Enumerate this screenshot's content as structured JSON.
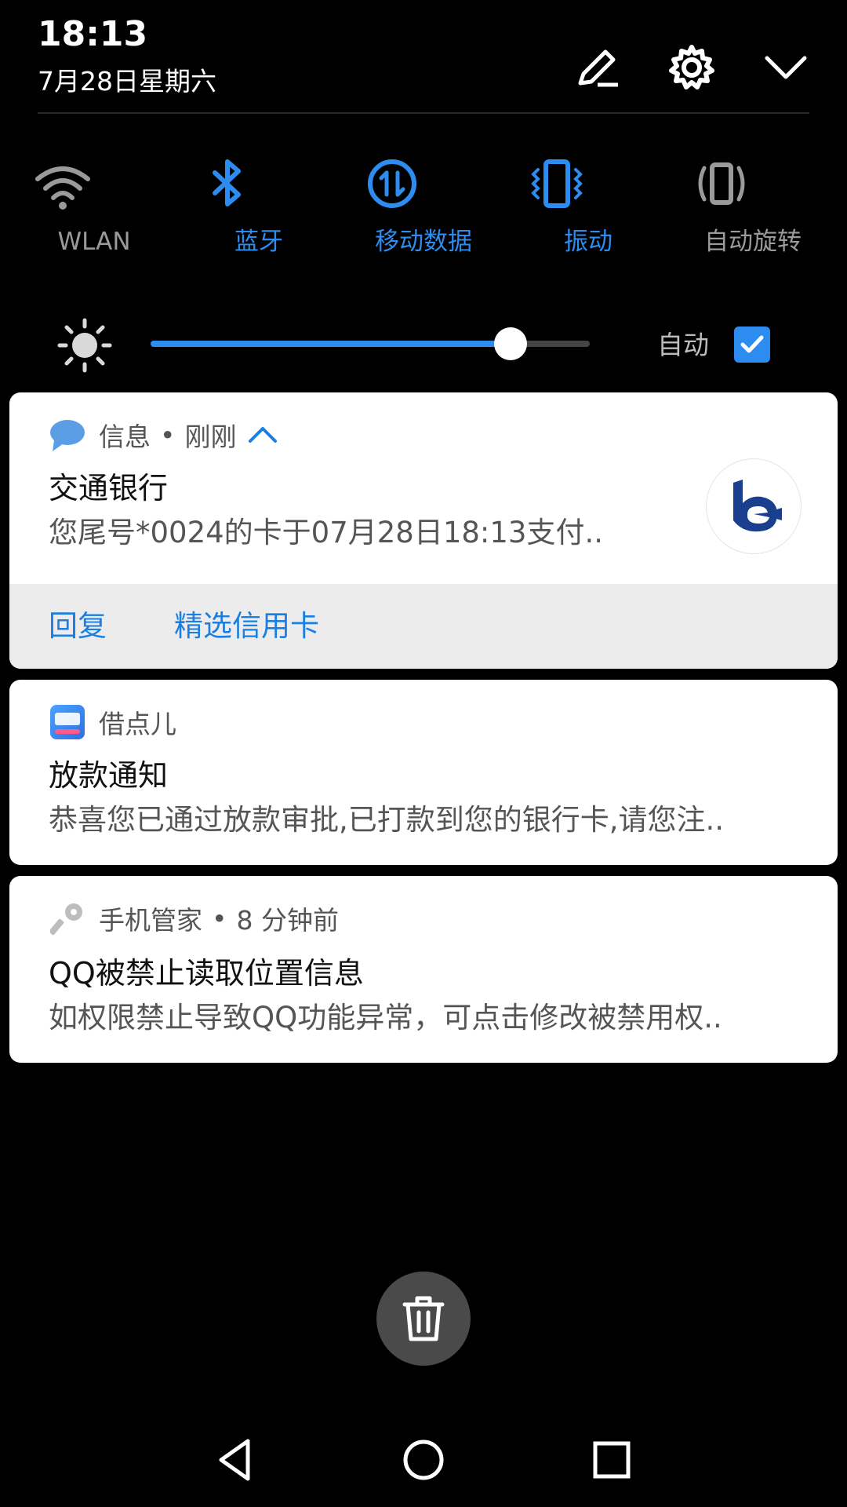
{
  "status": {
    "time": "18:13",
    "date": "7月28日星期六"
  },
  "header_icons": [
    "edit-icon",
    "settings-icon",
    "chevron-down-icon"
  ],
  "quick_settings": [
    {
      "label": "WLAN",
      "icon": "wifi-icon",
      "active": false
    },
    {
      "label": "蓝牙",
      "icon": "bluetooth-icon",
      "active": true
    },
    {
      "label": "移动数据",
      "icon": "mobile-data-icon",
      "active": true
    },
    {
      "label": "振动",
      "icon": "vibrate-icon",
      "active": true
    },
    {
      "label": "自动旋转",
      "icon": "auto-rotate-icon",
      "active": false
    }
  ],
  "brightness": {
    "level": 0.82,
    "auto_label": "自动",
    "auto_checked": true
  },
  "notifications": [
    {
      "app": "信息",
      "time": "刚刚",
      "title": "交通银行",
      "body": "您尾号*0024的卡于07月28日18:13支付..",
      "actions": [
        "回复",
        "精选信用卡"
      ]
    },
    {
      "app": "借点儿",
      "title": "放款通知",
      "body": "恭喜您已通过放款审批,已打款到您的银行卡,请您注.."
    },
    {
      "app": "手机管家",
      "time": "8 分钟前",
      "title": "QQ被禁止读取位置信息",
      "body": "如权限禁止导致QQ功能异常，可点击修改被禁用权.."
    }
  ],
  "colors": {
    "accent": "#2d8cf0",
    "background": "#000000",
    "card": "#ffffff"
  }
}
